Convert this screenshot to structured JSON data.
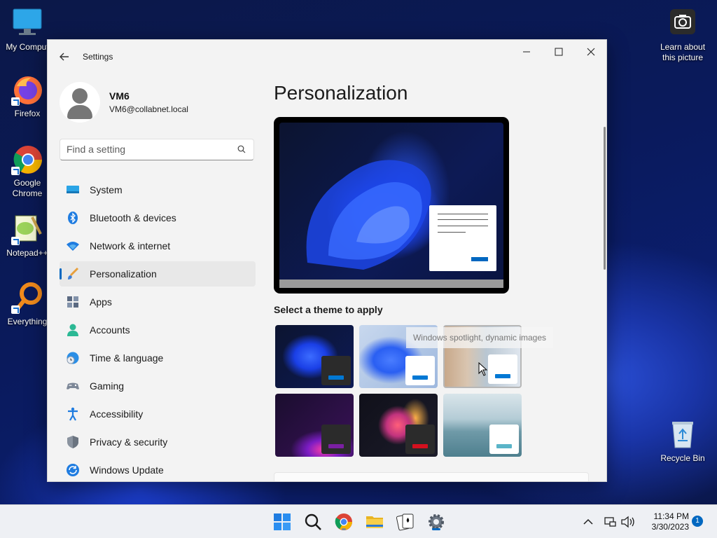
{
  "desktop": {
    "icons": [
      {
        "label": "My Comput"
      },
      {
        "label": "Firefox"
      },
      {
        "label": "Google Chrome"
      },
      {
        "label": "Notepad++"
      },
      {
        "label": "Everything"
      },
      {
        "label": "Learn about this picture"
      },
      {
        "label": "Recycle Bin"
      }
    ]
  },
  "window": {
    "title": "Settings",
    "back_icon": "back-arrow-icon",
    "controls": [
      "minimize-icon",
      "maximize-icon",
      "close-icon"
    ]
  },
  "profile": {
    "name": "VM6",
    "email": "VM6@collabnet.local"
  },
  "search": {
    "placeholder": "Find a setting"
  },
  "nav": {
    "items": [
      {
        "label": "System",
        "icon": "system-icon"
      },
      {
        "label": "Bluetooth & devices",
        "icon": "bluetooth-icon"
      },
      {
        "label": "Network & internet",
        "icon": "wifi-icon"
      },
      {
        "label": "Personalization",
        "icon": "brush-icon",
        "active": true
      },
      {
        "label": "Apps",
        "icon": "apps-icon"
      },
      {
        "label": "Accounts",
        "icon": "accounts-icon"
      },
      {
        "label": "Time & language",
        "icon": "globe-clock-icon"
      },
      {
        "label": "Gaming",
        "icon": "gamepad-icon"
      },
      {
        "label": "Accessibility",
        "icon": "accessibility-icon"
      },
      {
        "label": "Privacy & security",
        "icon": "shield-icon"
      },
      {
        "label": "Windows Update",
        "icon": "update-icon"
      }
    ]
  },
  "main": {
    "title": "Personalization",
    "themes_label": "Select a theme to apply",
    "tooltip": "Windows spotlight, dynamic images",
    "themes": [
      {
        "name": "windows-dark",
        "accent": "#0078d4"
      },
      {
        "name": "windows-light",
        "accent": "#0078d4"
      },
      {
        "name": "windows-spotlight",
        "accent": "#0078d4"
      },
      {
        "name": "glow",
        "accent": "#7a1fa2"
      },
      {
        "name": "captured-motion",
        "accent": "#d4101e"
      },
      {
        "name": "flow",
        "accent": "#3a9bb0"
      }
    ]
  },
  "taskbar": {
    "time": "11:34 PM",
    "date": "3/30/2023",
    "notification_count": "1",
    "accent": "#0067c0"
  }
}
